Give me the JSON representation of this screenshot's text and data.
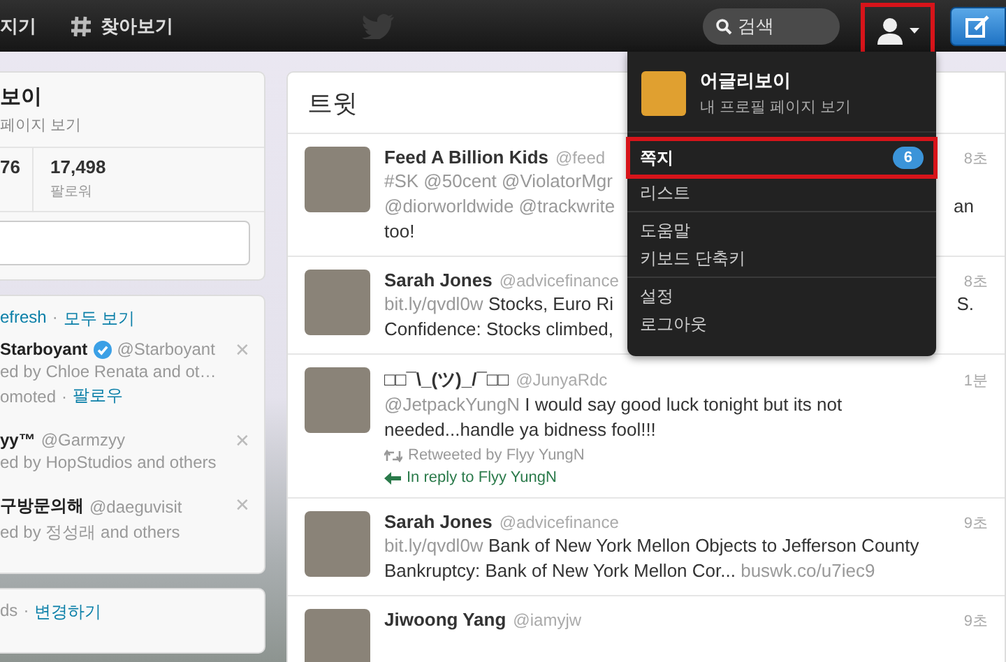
{
  "top_bar": {
    "nav": [
      {
        "kind": "plain",
        "label": "지기"
      },
      {
        "kind": "hash",
        "label": "찾아보기"
      }
    ],
    "search": {
      "placeholder": "검색"
    },
    "user_menu": {
      "highlighted": true
    }
  },
  "profile_card": {
    "name": "보이",
    "link": "페이지 보기",
    "stats": [
      {
        "value": "76"
      },
      {
        "value": "17,498",
        "label": "팔로워"
      }
    ]
  },
  "suggestions": {
    "actions": [
      "efresh",
      "모두 보기"
    ],
    "separator": "·",
    "items": [
      {
        "name": "Starboyant",
        "verified": true,
        "handle": "@Starboyant",
        "note": "ed by Chloe Renata and ot…",
        "promo": "omoted",
        "promo_separator": "·",
        "follow": "팔로우",
        "dismiss": "✕"
      },
      {
        "name": "yy™",
        "verified": false,
        "handle": "@Garmzyy",
        "note": "ed by HopStudios and others",
        "dismiss": "✕"
      },
      {
        "name": "구방문의해",
        "verified": false,
        "handle": "@daeguvisit",
        "note": "ed by 정성래 and others",
        "dismiss": "✕"
      }
    ]
  },
  "trends_footer": {
    "text": "ds",
    "separator": "·",
    "link": "변경하기"
  },
  "timeline": {
    "title": "트윗",
    "tweets": [
      {
        "name": "Feed A Billion Kids",
        "handle": "@feed",
        "time": "8초",
        "lines": [
          {
            "parts": [
              {
                "kind": "link",
                "text": "#SK @50cent @ViolatorMgr"
              }
            ]
          },
          {
            "parts": [
              {
                "kind": "link",
                "text": "@diorworldwide @trackwrite"
              }
            ],
            "right": "an"
          },
          {
            "parts": [
              {
                "kind": "plain",
                "text": "too!"
              }
            ]
          }
        ]
      },
      {
        "name": "Sarah Jones",
        "handle": "@advicefinance",
        "time": "8초",
        "lines": [
          {
            "parts": [
              {
                "kind": "link",
                "text": "bit.ly/qvdl0w"
              },
              {
                "kind": "plain",
                "text": "Stocks, Euro Ri"
              }
            ],
            "right": "S."
          },
          {
            "parts": [
              {
                "kind": "plain",
                "text": "Confidence: Stocks climbed,"
              }
            ]
          }
        ]
      },
      {
        "name": "□□¯\\_(ツ)_/¯□□",
        "handle": "@JunyaRdc",
        "time": "1분",
        "lines": [
          {
            "parts": [
              {
                "kind": "link",
                "text": "@JetpackYungN"
              },
              {
                "kind": "plain",
                "text": "I would say good luck tonight but its not"
              }
            ]
          },
          {
            "parts": [
              {
                "kind": "plain",
                "text": "needed...handle ya bidness fool!!!"
              }
            ]
          }
        ],
        "retweeted_by": "Retweeted by Flyy YungN",
        "in_reply_to": "In reply to Flyy YungN"
      },
      {
        "name": "Sarah Jones",
        "handle": "@advicefinance",
        "time": "9초",
        "lines": [
          {
            "parts": [
              {
                "kind": "link",
                "text": "bit.ly/qvdl0w"
              },
              {
                "kind": "plain",
                "text": "Bank of New York Mellon Objects to Jefferson County"
              }
            ]
          },
          {
            "parts": [
              {
                "kind": "plain",
                "text": "Bankruptcy: Bank of New York Mellon Cor..."
              },
              {
                "kind": "link",
                "text": "buswk.co/u7iec9"
              }
            ]
          }
        ]
      },
      {
        "name": "Jiwoong Yang",
        "handle": "@iamyjw",
        "time": "9초"
      }
    ]
  },
  "dropdown": {
    "profile": {
      "name": "어글리보이",
      "link": "내 프로필 페이지 보기"
    },
    "groups": [
      [
        {
          "label": "쪽지",
          "badge": "6",
          "highlighted": true
        },
        {
          "label": "리스트",
          "highlighted": false
        }
      ],
      [
        {
          "label": "도움말",
          "highlighted": false
        },
        {
          "label": "키보드 단축키",
          "highlighted": false
        }
      ],
      [
        {
          "label": "설정",
          "highlighted": false
        },
        {
          "label": "로그아웃",
          "highlighted": false
        }
      ]
    ]
  }
}
